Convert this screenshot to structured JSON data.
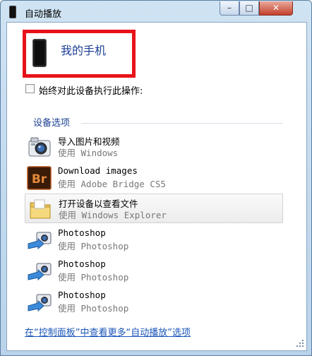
{
  "window": {
    "title": "自动播放",
    "controls": {
      "minimize": "–",
      "maximize": "□",
      "close": "✕"
    }
  },
  "device": {
    "name": "我的手机",
    "icon": "phone-icon"
  },
  "always_checkbox": {
    "label": "始终对此设备执行此操作:",
    "checked": false
  },
  "section": {
    "title": "设备选项"
  },
  "options": [
    {
      "name": "导入图片和视频",
      "sub": "使用 Windows",
      "icon": "camera-icon"
    },
    {
      "name": "Download images",
      "sub": "使用 Adobe Bridge CS5",
      "icon": "adobe-bridge-icon"
    },
    {
      "name": "打开设备以查看文件",
      "sub": "使用 Windows Explorer",
      "icon": "folder-icon"
    },
    {
      "name": "Photoshop",
      "sub": "使用 Photoshop",
      "icon": "camera-import-icon"
    },
    {
      "name": "Photoshop",
      "sub": "使用 Photoshop",
      "icon": "camera-import-icon"
    },
    {
      "name": "Photoshop",
      "sub": "使用 Photoshop",
      "icon": "camera-import-icon"
    }
  ],
  "footer": {
    "link": "在“控制面板”中查看更多“自动播放”选项"
  },
  "colors": {
    "device_highlight": "#e8131a",
    "link": "#1a55b8",
    "heading": "#1c3f93"
  }
}
